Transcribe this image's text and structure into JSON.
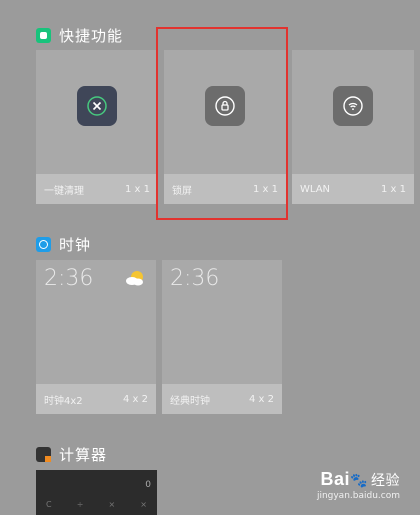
{
  "quick": {
    "title": "快捷功能",
    "tiles": [
      {
        "name": "一键清理",
        "size": "1 x 1"
      },
      {
        "name": "锁屏",
        "size": "1 x 1"
      },
      {
        "name": "WLAN",
        "size": "1 x 1"
      }
    ]
  },
  "clock": {
    "title": "时钟",
    "widgets": [
      {
        "time": "2:36",
        "name": "时钟4x2",
        "size": "4 x 2"
      },
      {
        "time": "2:36",
        "name": "经典时钟",
        "size": "4 x 2"
      }
    ]
  },
  "calculator": {
    "title": "计算器",
    "display": "0",
    "keys": [
      "C",
      "÷",
      "×",
      "×"
    ]
  },
  "watermark": {
    "brand_left": "Bai",
    "brand_right": "经验",
    "url": "jingyan.baidu.com"
  },
  "colors": {
    "highlight": "#e2332f",
    "quick_icon": "#18c37c",
    "clock_icon": "#1f9de8"
  }
}
